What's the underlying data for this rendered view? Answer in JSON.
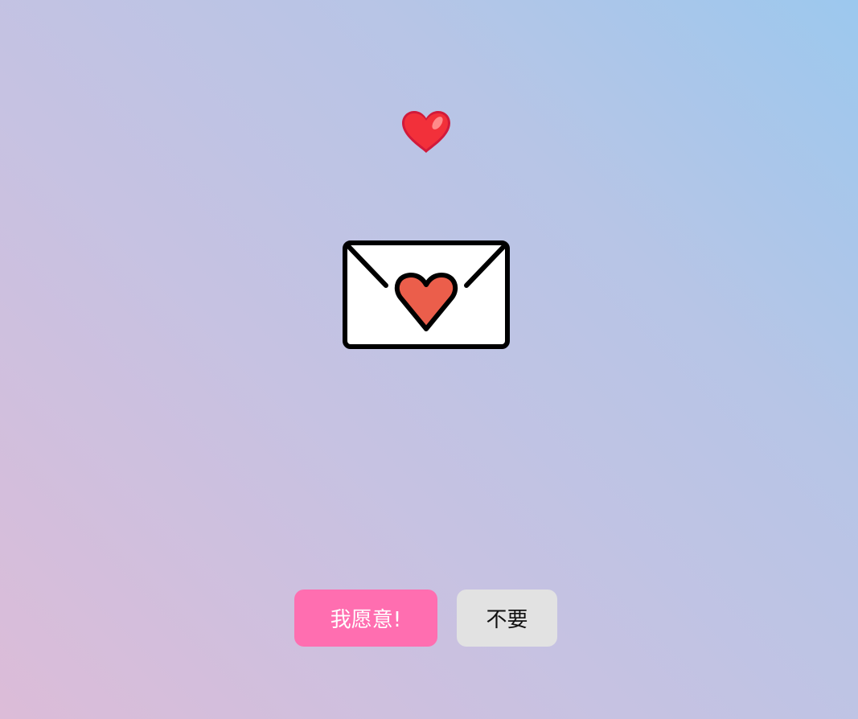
{
  "icons": {
    "floating_heart": "red-heart-icon",
    "letter": "love-letter-envelope-icon"
  },
  "colors": {
    "yes_button": "#ff6eb0",
    "no_button": "#e2e2e2",
    "heart_red": "#ee2b33",
    "envelope_heart": "#eb5e4b"
  },
  "actions": {
    "yes_label": "我愿意!",
    "no_label": "不要"
  }
}
